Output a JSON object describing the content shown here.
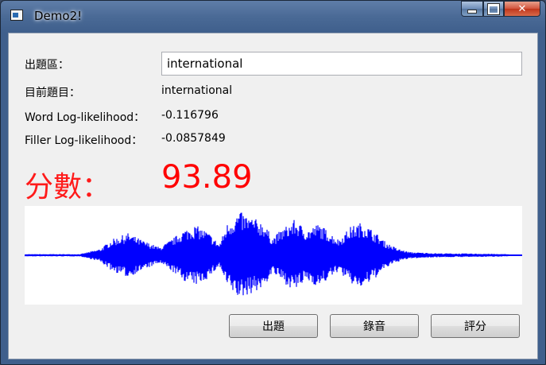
{
  "window": {
    "title": "Demo2!"
  },
  "colors": {
    "score": "#ff0000",
    "waveform": "#0000ff"
  },
  "fields": {
    "question_label": "出題區：",
    "question_value": "international",
    "current_label": "目前題目：",
    "current_value": "international",
    "word_ll_label": "Word Log-likelihood：",
    "word_ll_value": "-0.116796",
    "filler_ll_label": "Filler Log-likelihood：",
    "filler_ll_value": "-0.0857849"
  },
  "score": {
    "label": "分數：",
    "value": "93.89"
  },
  "buttons": {
    "question": "出題",
    "record": "錄音",
    "evaluate": "評分"
  },
  "icons": {
    "app": "app-window-icon",
    "minimize": "minimize-icon",
    "maximize": "maximize-icon",
    "close": "close-icon"
  }
}
